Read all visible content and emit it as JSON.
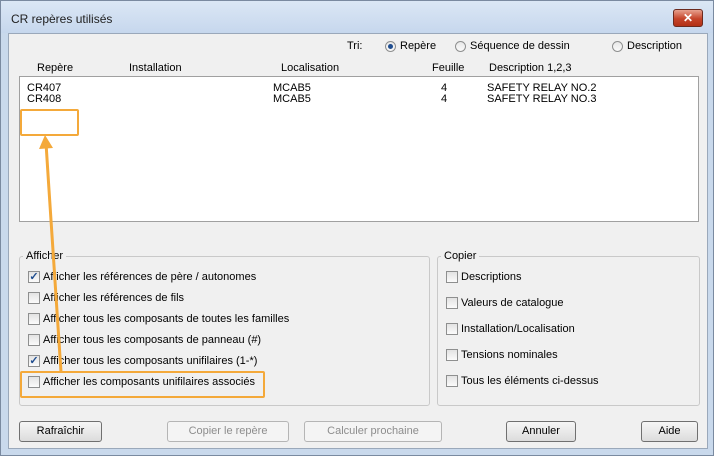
{
  "window": {
    "title": "CR repères utilisés",
    "close_glyph": "✕"
  },
  "sort": {
    "label": "Tri:",
    "options": [
      {
        "label": "Repère",
        "checked": true
      },
      {
        "label": "Séquence de dessin",
        "checked": false
      },
      {
        "label": "Description",
        "checked": false
      }
    ]
  },
  "table": {
    "headers": [
      "Repère",
      "Installation",
      "Localisation",
      "Feuille",
      "Description 1,2,3"
    ],
    "rows": [
      {
        "repere": "CR407",
        "installation": "",
        "localisation": "MCAB5",
        "feuille": "4",
        "description": "SAFETY RELAY NO.2"
      },
      {
        "repere": "CR408",
        "installation": "",
        "localisation": "MCAB5",
        "feuille": "4",
        "description": "SAFETY RELAY NO.3"
      }
    ]
  },
  "afficher": {
    "title": "Afficher",
    "items": [
      {
        "label": "Afficher les références de père / autonomes",
        "checked": true
      },
      {
        "label": "Afficher les références de fils",
        "checked": false
      },
      {
        "label": "Afficher tous les composants de toutes les familles",
        "checked": false
      },
      {
        "label": "Afficher tous les composants de panneau (#)",
        "checked": false
      },
      {
        "label": "Afficher tous les composants unifilaires (1-*)",
        "checked": true
      },
      {
        "label": "Afficher les composants unifilaires associés",
        "checked": false
      }
    ]
  },
  "copier": {
    "title": "Copier",
    "items": [
      {
        "label": "Descriptions",
        "checked": false
      },
      {
        "label": "Valeurs de catalogue",
        "checked": false
      },
      {
        "label": "Installation/Localisation",
        "checked": false
      },
      {
        "label": "Tensions nominales",
        "checked": false
      },
      {
        "label": "Tous les éléments ci-dessus",
        "checked": false
      }
    ]
  },
  "buttons": {
    "refresh": "Rafraîchir",
    "copy_tag": "Copier le repère",
    "calc_next": "Calculer prochaine",
    "cancel": "Annuler",
    "help": "Aide"
  },
  "accent_color": "#f4a93a",
  "check_glyph": "✓"
}
